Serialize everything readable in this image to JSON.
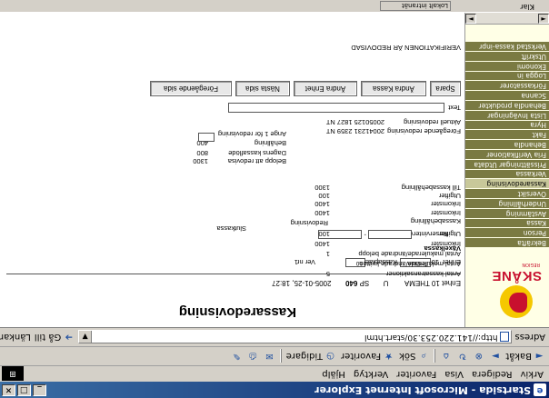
{
  "window": {
    "title": "Startsida - Microsoft Internet Explorer",
    "buttons": {
      "minimize": "_",
      "maximize": "□",
      "close": "×"
    }
  },
  "menubar": [
    "Arkiv",
    "Redigera",
    "Visa",
    "Favoriter",
    "Verktyg",
    "Hjälp"
  ],
  "toolbar": {
    "back": "Bakåt",
    "search": "Sök",
    "favorites": "Favoriter",
    "history": "Tidigare"
  },
  "address": {
    "label": "Adress",
    "url": "http://141.220.253.30/start.html",
    "go": "Gå till",
    "links": "Länkar"
  },
  "nav": {
    "logo_text": "SKÅNE",
    "logo_sub": "REGION",
    "items": [
      "Bekräfta",
      "Person",
      "Kassa",
      "Avstämning",
      "Underhållning",
      "Översikt",
      "Kassaredovisning",
      "Verkassa",
      "Prissättningar Utdata",
      "Fria Verifikationer",
      "Behandla",
      "Fakt",
      "Hyra",
      "Lista Invägningar",
      "Behandla produkter",
      "Scanna",
      "Förkassatorer",
      "Logga in",
      "Ekonomi",
      "Utskrift",
      "Verkstad kassa-inpr"
    ],
    "highlight_index": 6
  },
  "form": {
    "heading": "Kassaredovisning",
    "enhet_label": "Enhet",
    "enhet_code": "10 THEMA",
    "u_label": "U",
    "sp_label": "SP",
    "sp_value": "640",
    "datetime": "2005-01-25, 18:27",
    "enhet_field_label": "Enhet",
    "enhet_field_code": "10",
    "enhet_field_value": "THEMA",
    "kassaplats_label": "Kassaplats",
    "kassaplats_value": "10",
    "version_label": "Ver nr",
    "version_value": "1",
    "vaxelkassa_label": "Växelkassa",
    "reservintervall_label": "Reservintervall",
    "dash": "-",
    "slutkassa_label": "Slutkassa",
    "redovisning_label": "Redovisning",
    "rows": [
      {
        "label": "Antal kassatransaktioner",
        "value": "5"
      },
      {
        "label": "Antal makulerade/ändrade kvitton",
        "value": ""
      },
      {
        "label": "Antal makulerade/ändrade belopp",
        "value": "1"
      },
      {
        "label": "Inkomster",
        "value": "1400"
      },
      {
        "label": "Utgifter",
        "value": "100"
      },
      {
        "label": "Kassabehållning",
        "value": ""
      },
      {
        "label": "Inkomster",
        "value": "1400"
      },
      {
        "label": "Inkomster",
        "value": "1400"
      },
      {
        "label": "Utgifter",
        "value": "100"
      },
      {
        "label": "Till kassabehållning",
        "value": "1300"
      }
    ],
    "right_rows": [
      {
        "label": "Belopp att redovisa",
        "value": "1300"
      },
      {
        "label": "Dagens kassaflöde",
        "value": "800"
      },
      {
        "label": "Behållning",
        "value": "400"
      },
      {
        "label": "Ange 1 för redovisning",
        "value": ""
      }
    ],
    "foregaende_label": "Föregående redovisning",
    "foregaende_value": "20041231 2359 NT",
    "aktuell_label": "Aktuell redovisning",
    "aktuell_value": "20050125 1827 NT",
    "text_label": "Text",
    "buttons": [
      "Spara",
      "Ändra Kassa",
      "Ändra Enhet",
      "Nästa sida",
      "Föregående sida"
    ],
    "footer": "VERIFIKATIONEN ÄR REDOVISAD"
  },
  "status": {
    "left": "Klar",
    "zone": "Lokalt intranät"
  }
}
